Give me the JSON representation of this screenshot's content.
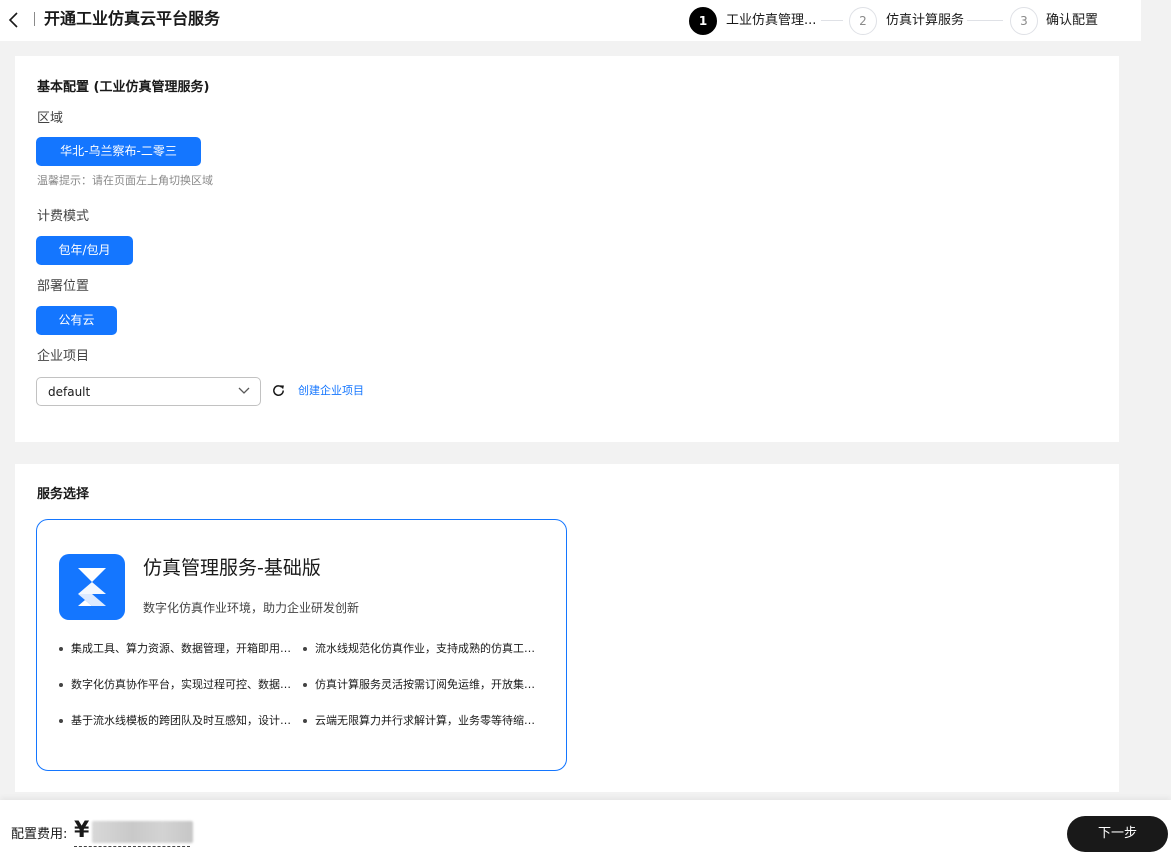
{
  "header": {
    "title": "开通工业仿真云平台服务",
    "steps": [
      {
        "number": "1",
        "label": "工业仿真管理...",
        "state": "active"
      },
      {
        "number": "2",
        "label": "仿真计算服务",
        "state": "todo"
      },
      {
        "number": "3",
        "label": "确认配置",
        "state": "todo"
      }
    ]
  },
  "basic_config": {
    "title": "基本配置 (工业仿真管理服务)",
    "region_label": "区域",
    "region_value": "华北-乌兰察布-二零三",
    "region_hint": "温馨提示：请在页面左上角切换区域",
    "billing_label": "计费模式",
    "billing_value": "包年/包月",
    "deploy_label": "部署位置",
    "deploy_value": "公有云",
    "project_label": "企业项目",
    "project_value": "default",
    "create_project_link": "创建企业项目"
  },
  "service_select": {
    "title": "服务选择",
    "card": {
      "name": "仿真管理服务-基础版",
      "description": "数字化仿真作业环境，助力企业研发创新",
      "features": [
        "集成工具、算力资源、数据管理，开箱即用的...",
        "流水线规范化仿真作业，支持成熟的仿真工具...",
        "数字化仿真协作平台，实现过程可控、数据可...",
        "仿真计算服务灵活按需订阅免运维，开放集成...",
        "基于流水线模板的跨团队及时互感知，设计仿...",
        "云端无限算力并行求解计算，业务零等待缩短..."
      ]
    }
  },
  "footer": {
    "fee_label": "配置费用:",
    "currency": "¥",
    "next_label": "下一步"
  },
  "colors": {
    "accent": "#1476ff",
    "primary_button": "#191919",
    "background": "#f2f2f2"
  }
}
